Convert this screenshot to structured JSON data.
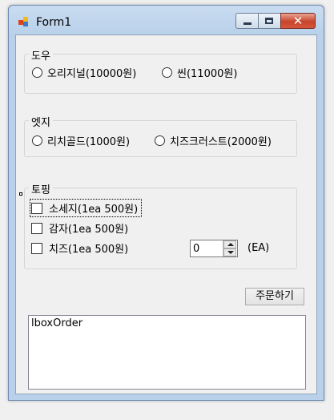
{
  "window": {
    "title": "Form1"
  },
  "dough": {
    "title": "도우",
    "options": [
      {
        "label": "오리지널(10000원)",
        "checked": false
      },
      {
        "label": "씬(11000원)",
        "checked": false
      }
    ]
  },
  "edge": {
    "title": "엣지",
    "options": [
      {
        "label": "리치골드(1000원)",
        "checked": false
      },
      {
        "label": "치즈크러스트(2000원)",
        "checked": false
      }
    ]
  },
  "topping": {
    "title": "토핑",
    "items": [
      {
        "label": "소세지(1ea 500원)",
        "checked": false
      },
      {
        "label": "감자(1ea 500원)",
        "checked": false
      },
      {
        "label": "치즈(1ea 500원)",
        "checked": false
      }
    ],
    "quantity": "0",
    "unit": "(EA)"
  },
  "order_button": "주문하기",
  "order_list": [
    "lboxOrder"
  ],
  "colors": {
    "frame": "#b9d1ea",
    "client": "#f0f0f0",
    "close": "#c7452c"
  }
}
